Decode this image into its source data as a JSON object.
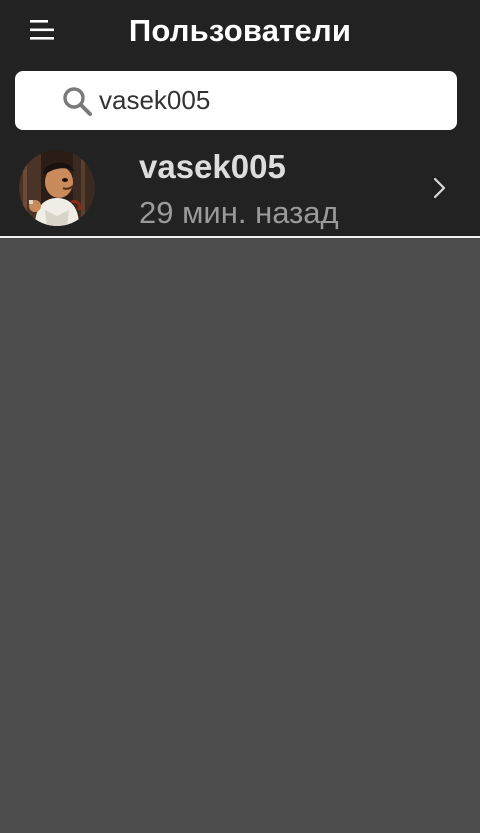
{
  "header": {
    "title": "Пользователи",
    "menu_icon": "hamburger-menu-icon"
  },
  "search": {
    "value": "vasek005",
    "icon": "search-icon"
  },
  "users": [
    {
      "name": "vasek005",
      "last_seen": "29 мин. назад",
      "avatar": "cartoon-character-avatar",
      "chevron_icon": "chevron-right-icon"
    }
  ],
  "colors": {
    "header_bg": "#222222",
    "body_bg": "#4d4d4d",
    "search_bg": "#ffffff",
    "name_text": "#dddddd",
    "status_text": "#9a9a9a"
  }
}
